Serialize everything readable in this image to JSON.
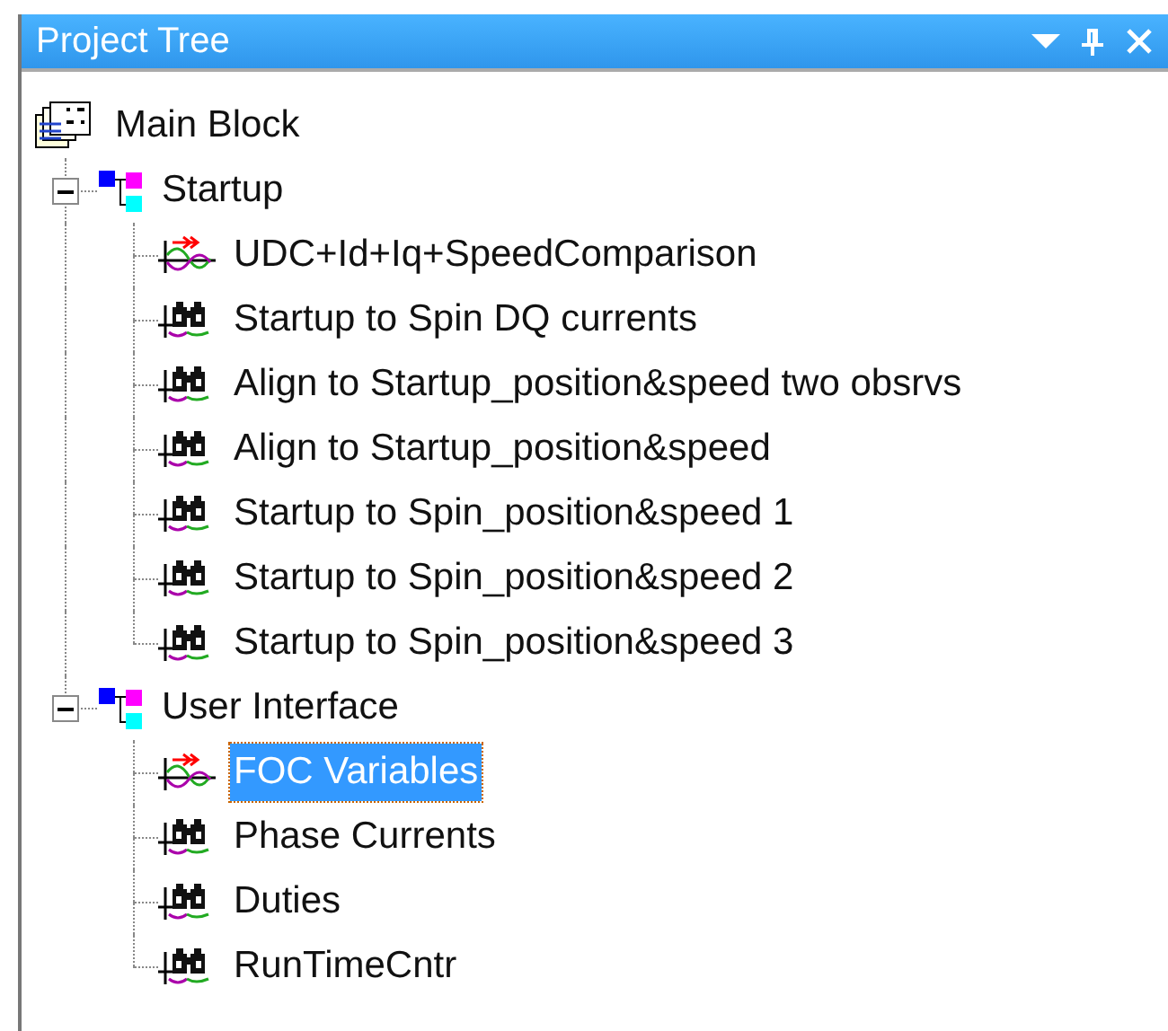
{
  "panel": {
    "title": "Project Tree"
  },
  "tree": {
    "label": "Main Block",
    "children": [
      {
        "label": "Startup",
        "expanded": true,
        "children": [
          {
            "label": "UDC+Id+Iq+SpeedComparison",
            "kind": "scope",
            "selected": false
          },
          {
            "label": "Startup to Spin DQ currents",
            "kind": "watch",
            "selected": false
          },
          {
            "label": "Align to Startup_position&speed two obsrvs",
            "kind": "watch",
            "selected": false
          },
          {
            "label": "Align to Startup_position&speed",
            "kind": "watch",
            "selected": false
          },
          {
            "label": "Startup to Spin_position&speed 1",
            "kind": "watch",
            "selected": false
          },
          {
            "label": "Startup to Spin_position&speed 2",
            "kind": "watch",
            "selected": false
          },
          {
            "label": "Startup to Spin_position&speed 3",
            "kind": "watch",
            "selected": false
          }
        ]
      },
      {
        "label": "User Interface",
        "expanded": true,
        "children": [
          {
            "label": "FOC Variables",
            "kind": "scope",
            "selected": true
          },
          {
            "label": "Phase Currents",
            "kind": "watch",
            "selected": false
          },
          {
            "label": "Duties",
            "kind": "watch",
            "selected": false
          },
          {
            "label": "RunTimeCntr",
            "kind": "watch",
            "selected": false
          }
        ]
      }
    ]
  }
}
